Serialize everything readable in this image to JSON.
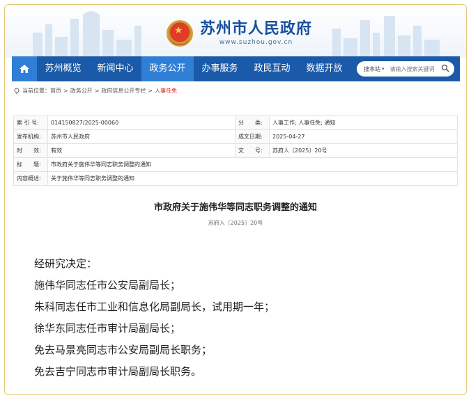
{
  "header": {
    "site_name": "苏州市人民政府",
    "site_url": "www.suzhou.gov.cn"
  },
  "nav": {
    "items": [
      "苏州概览",
      "新闻中心",
      "政务公开",
      "办事服务",
      "政民互动",
      "数据开放"
    ],
    "active": "政务公开",
    "search": {
      "scope": "搜本站",
      "placeholder": "请输入搜索关键词"
    }
  },
  "breadcrumb": {
    "label": "当前位置：",
    "items": [
      "首页",
      "政务公开",
      "政府信息公开专栏",
      "人事任免"
    ],
    "separator": ">"
  },
  "meta": {
    "index_label": "索 引 号:",
    "index_value": "014150827/2025-00060",
    "category_label": "分　　类:",
    "category_value": "人事工作;  人事任免;  通知",
    "publisher_label": "发布机构:",
    "publisher_value": "苏州市人民政府",
    "date_label": "成文日期:",
    "date_value": "2025-04-27",
    "validity_label": "时　　效:",
    "validity_value": "有效",
    "docno_label": "文　　号:",
    "docno_value": "苏府人〔2025〕20号",
    "title_label": "标　　题:",
    "title_value": "市政府关于施伟华等同志职务调整的通知",
    "summary_label": "内容概述:",
    "summary_value": "关于施伟华等同志职务调整的通知"
  },
  "document": {
    "title": "市政府关于施伟华等同志职务调整的通知",
    "number": "苏府人〔2025〕20号",
    "lines": [
      "经研究决定：",
      "施伟华同志任市公安局副局长；",
      "朱科同志任市工业和信息化局副局长，试用期一年；",
      "徐华东同志任市审计局副局长；",
      "免去马景亮同志市公安局副局长职务；",
      "免去吉宁同志市审计局副局长职务。"
    ]
  },
  "colors": {
    "nav_bg": "#1b5aa8",
    "nav_active": "#2f7fd6",
    "title_blue": "#1a4f9c",
    "frame_border": "#e3c77a",
    "breadcrumb_current": "#c4302b"
  }
}
